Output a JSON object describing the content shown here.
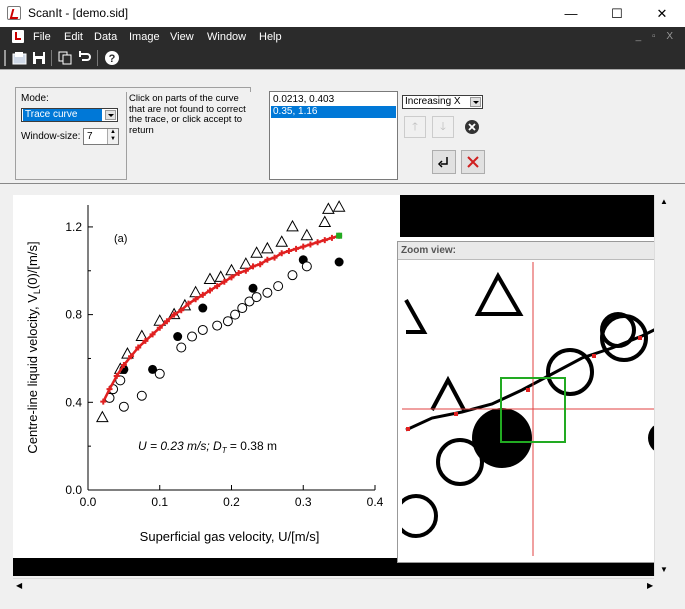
{
  "window": {
    "title": "ScanIt - [demo.sid]",
    "minimize": "—",
    "maximize": "☐",
    "close": "✕"
  },
  "menu": {
    "items": [
      "File",
      "Edit",
      "Data",
      "Image",
      "View",
      "Window",
      "Help"
    ],
    "mdi_controls": "_ ▫ X"
  },
  "toolbar": {
    "icons": [
      "open-icon",
      "save-icon",
      "copy-icon",
      "undo-icon",
      "help-icon"
    ]
  },
  "panel": {
    "mode_label": "Mode:",
    "mode_value": "Trace curve",
    "window_size_label": "Window-size:",
    "window_size_value": "7",
    "instructions": "Click on parts of the curve that are not found to correct the trace, or click accept to return",
    "points": [
      "0.0213, 0.403",
      "0.35, 1.16"
    ],
    "selected_point_index": 1,
    "direction_value": "Increasing X"
  },
  "zoom": {
    "title": "Zoom view:",
    "close": "×"
  },
  "chart_data": {
    "type": "scatter",
    "title": "",
    "panel_label": "(a)",
    "annotation": "U = 0.23 m/s; D",
    "annotation_sub": "T",
    "annotation_end": " = 0.38 m",
    "xlabel": "Superficial gas velocity, U/[m/s]",
    "ylabel": "Centre-line liquid velocity, V",
    "ylabel_sub": "L",
    "ylabel_end": "(0)/[m/s]",
    "xlim": [
      0,
      0.4
    ],
    "ylim": [
      0,
      1.3
    ],
    "xticks": [
      "0.0",
      "0.1",
      "0.2",
      "0.3",
      "0.4"
    ],
    "yticks": [
      "0.0",
      "0.4",
      "0.8",
      "1.2"
    ],
    "series": [
      {
        "marker": "triangle",
        "x": [
          0.02,
          0.045,
          0.055,
          0.075,
          0.1,
          0.12,
          0.135,
          0.15,
          0.17,
          0.185,
          0.2,
          0.22,
          0.235,
          0.25,
          0.27,
          0.285,
          0.305,
          0.33,
          0.335,
          0.35
        ],
        "y": [
          0.33,
          0.55,
          0.62,
          0.7,
          0.77,
          0.8,
          0.84,
          0.9,
          0.96,
          0.97,
          1.0,
          1.03,
          1.08,
          1.1,
          1.13,
          1.2,
          1.16,
          1.22,
          1.28,
          1.29
        ]
      },
      {
        "marker": "filled-circle",
        "x": [
          0.05,
          0.09,
          0.125,
          0.16,
          0.23,
          0.3,
          0.35
        ],
        "y": [
          0.55,
          0.55,
          0.7,
          0.83,
          0.92,
          1.05,
          1.04
        ]
      },
      {
        "marker": "open-circle",
        "x": [
          0.03,
          0.035,
          0.045,
          0.05,
          0.075,
          0.1,
          0.13,
          0.145,
          0.16,
          0.18,
          0.195,
          0.205,
          0.215,
          0.225,
          0.235,
          0.25,
          0.265,
          0.285,
          0.305
        ],
        "y": [
          0.42,
          0.46,
          0.5,
          0.38,
          0.43,
          0.53,
          0.65,
          0.7,
          0.73,
          0.75,
          0.77,
          0.8,
          0.83,
          0.86,
          0.88,
          0.9,
          0.93,
          0.98,
          1.02
        ]
      },
      {
        "marker": "trace",
        "color": "#e02020",
        "x": [
          0.0213,
          0.03,
          0.04,
          0.05,
          0.06,
          0.07,
          0.08,
          0.09,
          0.1,
          0.11,
          0.12,
          0.13,
          0.14,
          0.15,
          0.16,
          0.17,
          0.18,
          0.19,
          0.2,
          0.21,
          0.22,
          0.23,
          0.24,
          0.25,
          0.26,
          0.27,
          0.28,
          0.29,
          0.3,
          0.31,
          0.32,
          0.33,
          0.34,
          0.35
        ],
        "y": [
          0.403,
          0.46,
          0.52,
          0.57,
          0.61,
          0.65,
          0.68,
          0.71,
          0.74,
          0.77,
          0.8,
          0.82,
          0.85,
          0.87,
          0.89,
          0.91,
          0.93,
          0.95,
          0.97,
          0.99,
          1.0,
          1.02,
          1.03,
          1.05,
          1.06,
          1.08,
          1.09,
          1.1,
          1.11,
          1.12,
          1.13,
          1.14,
          1.15,
          1.16
        ]
      }
    ]
  },
  "colors": {
    "selection": "#0078d7",
    "trace": "#e02020",
    "zoom_box": "#22aa22",
    "crosshair": "#e04040",
    "menubar": "#2b2b2b"
  }
}
